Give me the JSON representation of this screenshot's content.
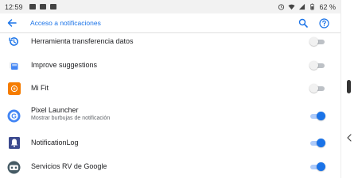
{
  "status_bar": {
    "time": "12:59",
    "battery": "62 %",
    "notif_icons": [
      "image-notification-icon",
      "image-notification-icon",
      "image-notification-icon"
    ]
  },
  "app_bar": {
    "title": "Acceso a notificaciones",
    "back_icon": "arrow-back-icon",
    "search_icon": "search-icon",
    "help_icon": "help-icon",
    "accent_color": "#1a73e8"
  },
  "apps": [
    {
      "name": "Herramienta transferencia datos",
      "subtitle": "",
      "enabled": false,
      "icon": "history-icon"
    },
    {
      "name": "Improve suggestions",
      "subtitle": "",
      "enabled": false,
      "icon": "improve-suggestions-icon"
    },
    {
      "name": "Mi Fit",
      "subtitle": "",
      "enabled": false,
      "icon": "mi-fit-icon"
    },
    {
      "name": "Pixel Launcher",
      "subtitle": "Mostrar burbujas de notificación",
      "enabled": true,
      "icon": "pixel-launcher-icon"
    },
    {
      "name": "NotificationLog",
      "subtitle": "",
      "enabled": true,
      "icon": "notification-bell-icon"
    },
    {
      "name": "Servicios RV de Google",
      "subtitle": "",
      "enabled": true,
      "icon": "vr-headset-icon"
    }
  ]
}
